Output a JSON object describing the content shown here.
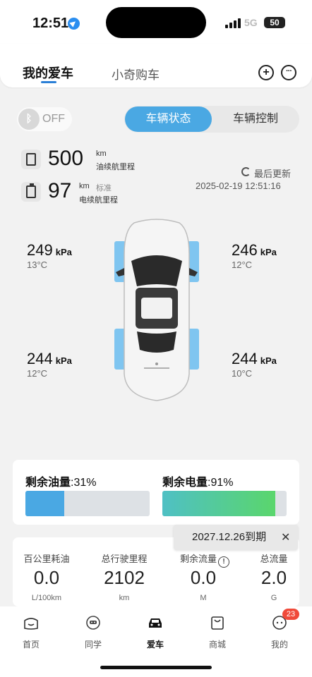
{
  "status_bar": {
    "time": "12:51",
    "network": "5G",
    "battery": "50"
  },
  "header": {
    "tabs": [
      {
        "label": "我的爱车",
        "active": true
      },
      {
        "label": "小奇购车",
        "active": false
      }
    ],
    "icons": [
      "plus-circle-icon",
      "chat-bubble-icon"
    ]
  },
  "bluetooth": {
    "state": "OFF"
  },
  "segment": {
    "active": "车辆状态",
    "inactive": "车辆控制"
  },
  "range": {
    "fuel": {
      "value": "500",
      "unit": "km",
      "label": "油续航里程"
    },
    "electric": {
      "value": "97",
      "unit": "km",
      "standard": "标准",
      "label": "电续航里程"
    }
  },
  "update": {
    "label": "最后更新",
    "datetime": "2025-02-19 12:51:16"
  },
  "tires": {
    "front_left": {
      "pressure": "249",
      "unit": "kPa",
      "temp": "13°C"
    },
    "front_right": {
      "pressure": "246",
      "unit": "kPa",
      "temp": "12°C"
    },
    "rear_left": {
      "pressure": "244",
      "unit": "kPa",
      "temp": "12°C"
    },
    "rear_right": {
      "pressure": "244",
      "unit": "kPa",
      "temp": "10°C"
    }
  },
  "levels": {
    "fuel": {
      "label": "剩余油量",
      "value": ":31%",
      "fraction": 0.31,
      "color": "#4aa8e3"
    },
    "electric": {
      "label": "剩余电量",
      "value": ":91%",
      "fraction": 0.91,
      "color": "#5ad66c"
    }
  },
  "tooltip": {
    "text": "2027.12.26到期"
  },
  "stats": [
    {
      "label": "百公里耗油",
      "value": "0.0",
      "unit": "L/100km"
    },
    {
      "label": "总行驶里程",
      "value": "2102",
      "unit": "km"
    },
    {
      "label": "剩余流量",
      "value": "0.0",
      "unit": "M"
    },
    {
      "label": "总流量",
      "value": "2.0",
      "unit": "G"
    }
  ],
  "nav": [
    {
      "label": "首页",
      "icon": "home-icon"
    },
    {
      "label": "同学",
      "icon": "classmate-icon"
    },
    {
      "label": "爱车",
      "icon": "car-icon",
      "active": true
    },
    {
      "label": "商城",
      "icon": "shop-icon"
    },
    {
      "label": "我的",
      "icon": "profile-icon",
      "badge": "23"
    }
  ]
}
